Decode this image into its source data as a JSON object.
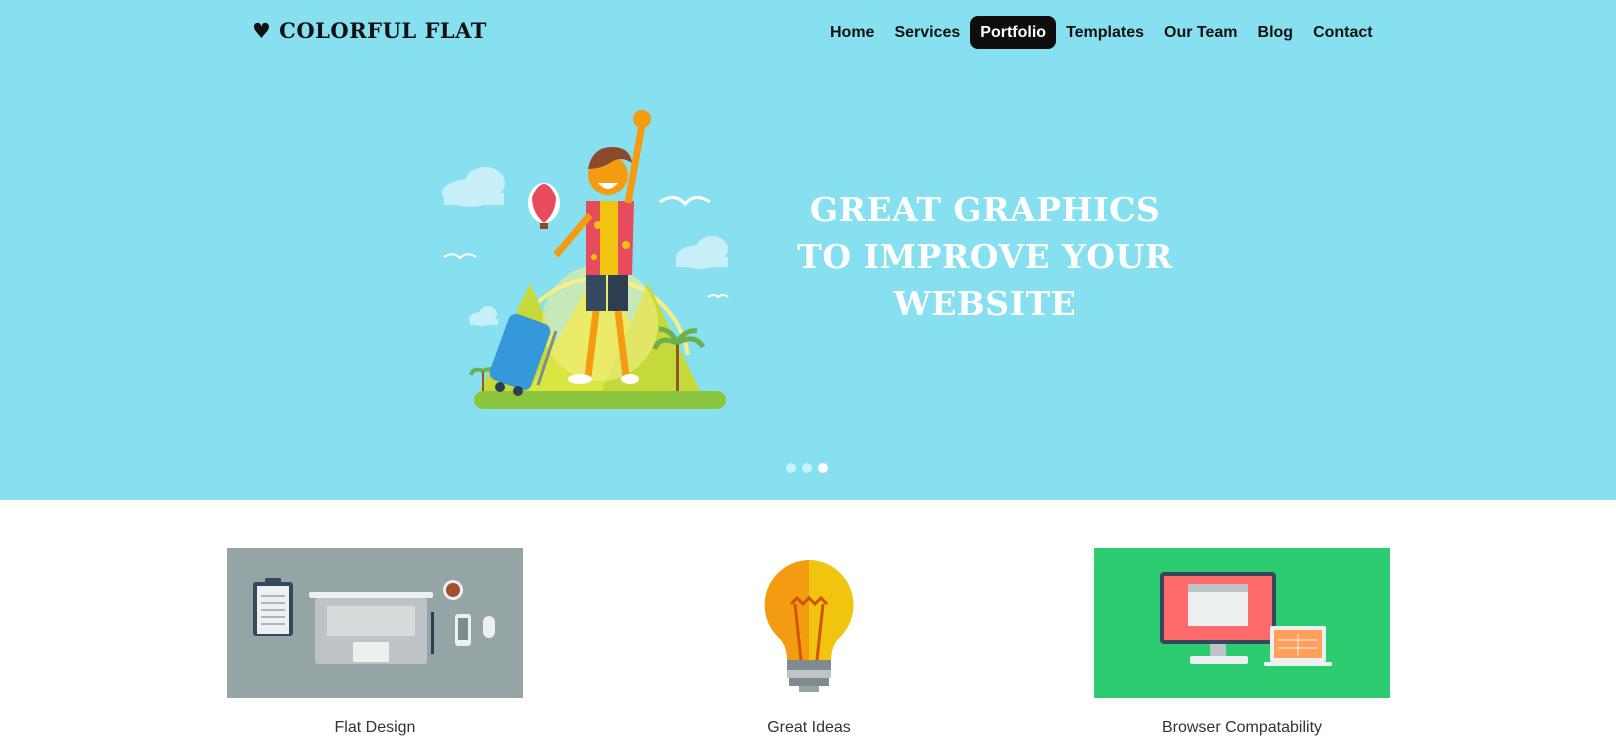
{
  "brand": {
    "heart": "♥",
    "name": "COLORFUL FLAT"
  },
  "nav": {
    "items": [
      "Home",
      "Services",
      "Portfolio",
      "Templates",
      "Our Team",
      "Blog",
      "Contact"
    ],
    "active": "Portfolio"
  },
  "hero": {
    "title_lines": [
      "GREAT GRAPHICS",
      "TO IMPROVE YOUR",
      "WEBSITE"
    ],
    "slide_count": 3,
    "active_slide": 3
  },
  "features": [
    {
      "caption": "Flat Design",
      "bg": "#95a5a6"
    },
    {
      "caption": "Great Ideas",
      "bg": "#ffffff"
    },
    {
      "caption": "Browser Compatability",
      "bg": "#2ecc71"
    }
  ],
  "colors": {
    "hero_bg": "#87e0f0",
    "nav_active_bg": "#0e0e0e"
  }
}
